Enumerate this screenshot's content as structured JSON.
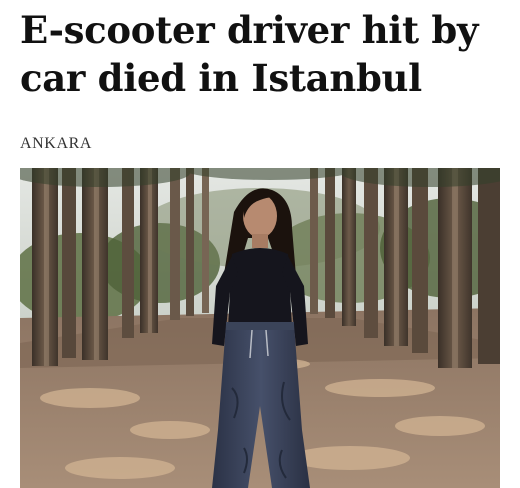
{
  "article": {
    "headline_line1": "E-scooter driver hit by",
    "headline_line2": "car died in Istanbul",
    "dateline": "ANKARA"
  },
  "photo": {
    "subject": "woman standing on forest dirt road",
    "colors": {
      "sky": "#d9dfdc",
      "trunk_dark": "#3f342b",
      "trunk_light": "#7a6654",
      "road": "#9a7f69",
      "sunlight": "#caa987",
      "foliage": "#556a3e",
      "shirt": "#15151d",
      "pants": "#3a4358",
      "hair": "#1b120d",
      "skin": "#b78a70"
    }
  }
}
